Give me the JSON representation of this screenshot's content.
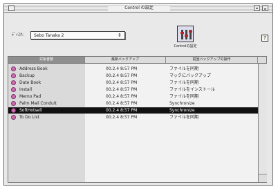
{
  "window": {
    "title": "Control の設定"
  },
  "toolbar": {
    "disk_label": "ﾃﾞｨｽｸ:",
    "disk_value": "Sebo Tanaka 2",
    "control_button_label": "Controlの設定",
    "help_label": "?"
  },
  "table": {
    "columns": [
      "対象書類",
      "最新バックアップ",
      "前回バックアップの操作"
    ],
    "rows": [
      {
        "name": "Address Book",
        "date": "00.2.4 8:57 PM",
        "action": "ファイルを同期"
      },
      {
        "name": "Backup",
        "date": "00.2.4 8:57 PM",
        "action": "マックにバックアップ"
      },
      {
        "name": "Date Book",
        "date": "00.2.4 8:57 PM",
        "action": "ファイルを同期"
      },
      {
        "name": "Install",
        "date": "00.2.4 8:57 PM",
        "action": "ファイルをインストール"
      },
      {
        "name": "Memo Pad",
        "date": "00.2.4 8:57 PM",
        "action": "ファイルを同期"
      },
      {
        "name": "Palm Mail Conduit",
        "date": "00.2.4 8:57 PM",
        "action": "Synchronize"
      },
      {
        "name": "SoftHotsell",
        "date": "00.2.4 8:57 PM",
        "action": "Synchronize"
      },
      {
        "name": "To Do List",
        "date": "00.2.4 8:57 PM",
        "action": "ファイルを同期"
      }
    ],
    "selected_index": 6
  }
}
